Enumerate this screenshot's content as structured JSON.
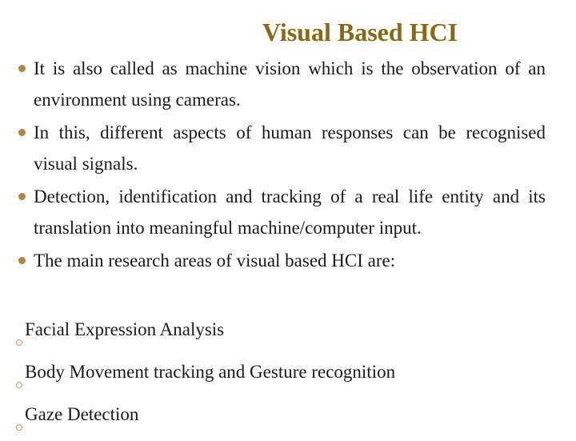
{
  "slide": {
    "title": "Visual Based HCI",
    "bullets": [
      {
        "text": "It is also called as machine vision which is the observation of an environment using cameras."
      },
      {
        "text": "In this, different aspects of human responses can be recognised visual signals."
      },
      {
        "text": "Detection, identification and tracking of a real life entity and its translation into meaningful machine/computer input."
      },
      {
        "text": "The main research areas of visual based HCI are:"
      }
    ],
    "sub_items": [
      {
        "text": "Facial Expression Analysis"
      },
      {
        "text": "Body Movement tracking and Gesture recognition"
      },
      {
        "text": "Gaze Detection"
      }
    ],
    "colors": {
      "title": "#8b6914",
      "bullet": "#b08a3e",
      "sub_bullet": "#b5a15e"
    }
  }
}
